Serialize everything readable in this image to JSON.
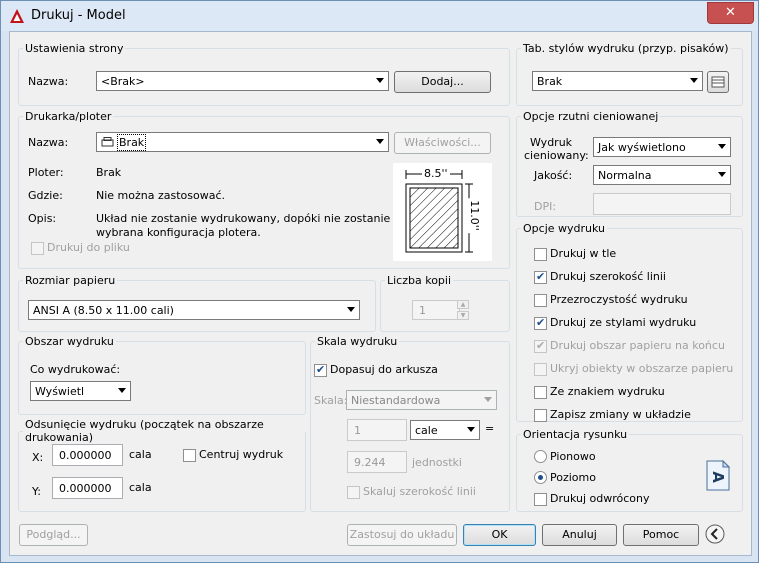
{
  "window": {
    "title": "Drukuj - Model",
    "close": "✕"
  },
  "page_setup": {
    "legend": "Ustawienia strony",
    "name_label": "Nazwa:",
    "name_value": "<Brak>",
    "add_button": "Dodaj..."
  },
  "plot_style": {
    "legend": "Tab. stylów wydruku (przyp. pisaków)",
    "value": "Brak"
  },
  "printer": {
    "legend": "Drukarka/ploter",
    "name_label": "Nazwa:",
    "name_value": "Brak",
    "properties_button": "Właściwości...",
    "plotter_label": "Ploter:",
    "plotter_value": "Brak",
    "where_label": "Gdzie:",
    "where_value": "Nie można zastosować.",
    "desc_label": "Opis:",
    "desc_line1": "Układ nie zostanie wydrukowany, dopóki nie zostanie",
    "desc_line2": "wybrana konfiguracja plotera.",
    "print_to_file": "Drukuj do pliku",
    "preview_width": "8.5''",
    "preview_height": "11.0''"
  },
  "shaded": {
    "legend": "Opcje rzutni cieniowanej",
    "print_label_1": "Wydruk",
    "print_label_2": "cieniowany:",
    "print_value": "Jak wyświetlono",
    "quality_label": "Jakość:",
    "quality_value": "Normalna",
    "dpi_label": "DPI:"
  },
  "paper": {
    "legend": "Rozmiar papieru",
    "value": "ANSI A (8.50 x 11.00 cali)"
  },
  "copies": {
    "legend": "Liczba kopii",
    "value": "1"
  },
  "plot_area": {
    "legend": "Obszar wydruku",
    "what_label": "Co wydrukować:",
    "what_value": "Wyświetl"
  },
  "plot_offset": {
    "legend": "Odsunięcie wydruku (początek na obszarze drukowania)",
    "x_label": "X:",
    "x_value": "0.000000",
    "x_unit": "cala",
    "y_label": "Y:",
    "y_value": "0.000000",
    "y_unit": "cala",
    "center": "Centruj wydruk"
  },
  "scale": {
    "legend": "Skala wydruku",
    "fit": "Dopasuj do arkusza",
    "scale_label": "Skala:",
    "scale_value": "Niestandardowa",
    "value1": "1",
    "unit1": "cale",
    "equals": "=",
    "value2": "9.244",
    "unit2": "jednostki",
    "lineweights": "Skaluj szerokość linii"
  },
  "options": {
    "legend": "Opcje wydruku",
    "items": [
      {
        "label": "Drukuj w tle",
        "checked": false,
        "disabled": false
      },
      {
        "label": "Drukuj szerokość linii",
        "checked": true,
        "disabled": false
      },
      {
        "label": "Przezroczystość wydruku",
        "checked": false,
        "disabled": false
      },
      {
        "label": "Drukuj ze stylami wydruku",
        "checked": true,
        "disabled": false
      },
      {
        "label": "Drukuj obszar papieru na końcu",
        "checked": true,
        "disabled": true
      },
      {
        "label": "Ukryj obiekty w obszarze papieru",
        "checked": false,
        "disabled": true
      },
      {
        "label": "Ze znakiem wydruku",
        "checked": false,
        "disabled": false
      },
      {
        "label": "Zapisz zmiany w układzie",
        "checked": false,
        "disabled": false
      }
    ]
  },
  "orientation": {
    "legend": "Orientacja rysunku",
    "portrait": "Pionowo",
    "landscape": "Poziomo",
    "upside": "Drukuj odwrócony",
    "icon_letter": "A"
  },
  "footer": {
    "preview": "Podgląd...",
    "apply": "Zastosuj do układu",
    "ok": "OK",
    "cancel": "Anuluj",
    "help": "Pomoc"
  },
  "colors": {
    "accent": "#1f4f86",
    "title_bar": "#dce8f6",
    "close": "#c75050"
  }
}
